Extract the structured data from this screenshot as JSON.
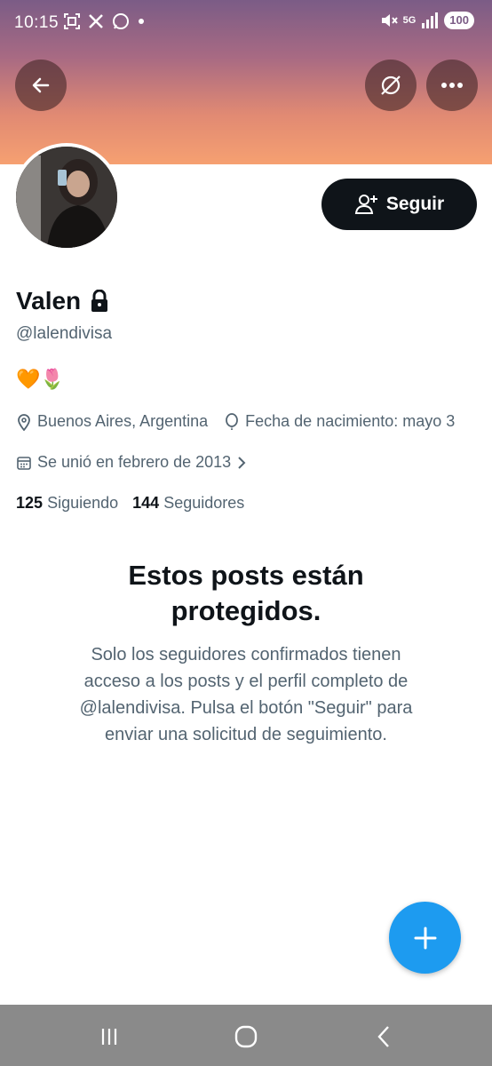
{
  "status_bar": {
    "time": "10:15",
    "network": "5G",
    "battery": "100"
  },
  "header": {
    "back_icon": "arrow-left-icon",
    "translate_icon": "globe-slash-icon",
    "more_icon": "more-horizontal-icon"
  },
  "profile": {
    "follow_label": "Seguir",
    "name": "Valen",
    "handle": "@lalendivisa",
    "bio": "🧡🌷",
    "location": "Buenos Aires, Argentina",
    "birthday": "Fecha de nacimiento: mayo 3",
    "joined": "Se unió en febrero de 2013",
    "following_count": "125",
    "following_label": "Siguiendo",
    "followers_count": "144",
    "followers_label": "Seguidores"
  },
  "protected": {
    "title_line1": "Estos posts están",
    "title_line2": "protegidos.",
    "desc_line1": "Solo los seguidores confirmados tienen",
    "desc_line2": "acceso a los posts y el perfil completo de",
    "desc_line3": "@lalendivisa. Pulsa el botón \"Seguir\" para",
    "desc_line4": "enviar una solicitud de seguimiento."
  },
  "colors": {
    "accent": "#1d9bf0",
    "text_primary": "#0f1419",
    "text_secondary": "#536471"
  }
}
